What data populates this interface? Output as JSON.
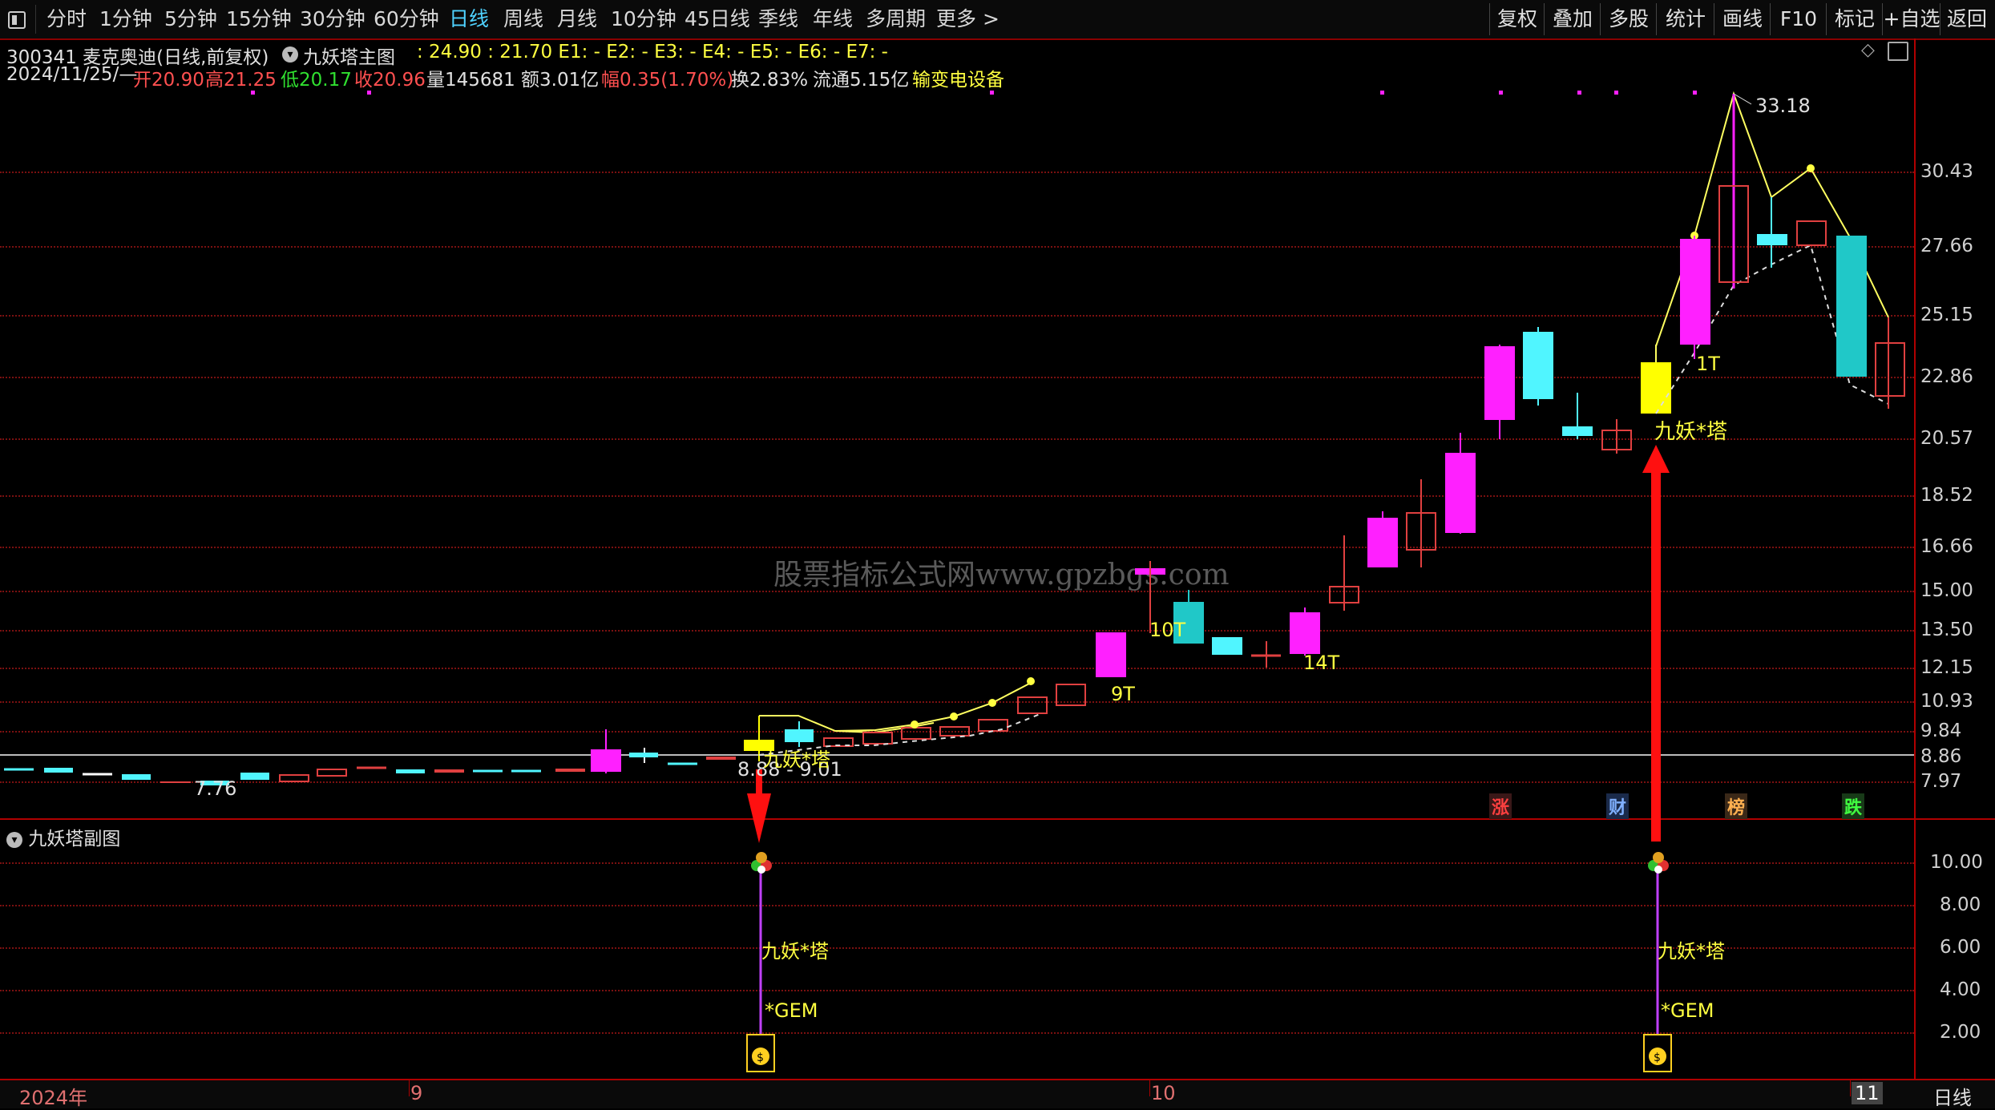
{
  "toolbar": {
    "menu_icon": "panel-toggle-icon",
    "periods": [
      "分时",
      "1分钟",
      "5分钟",
      "15分钟",
      "30分钟",
      "60分钟",
      "日线",
      "周线",
      "月线",
      "10分钟",
      "45日线",
      "季线",
      "年线",
      "多周期",
      "更多"
    ],
    "active_period": "日线",
    "more_arrow": ">",
    "right": [
      "复权",
      "叠加",
      "多股",
      "统计",
      "画线",
      "F10",
      "标记",
      "+自选",
      "返回"
    ]
  },
  "header": {
    "code_name": "300341 麦克奥迪(日线,前复权)",
    "indicator": "九妖塔主图",
    "ind_values": ": 24.90 : 21.70 E1: - E2: - E3: - E4: - E5: - E6: - E7: -",
    "date": "2024/11/25/—",
    "open": "开20.90",
    "high": "高21.25",
    "low": "低20.17",
    "close": "收20.96",
    "volume": "量145681",
    "amount": "额3.01亿",
    "change": "幅0.35(1.70%)",
    "turnover": "换2.83%",
    "float": "流通5.15亿",
    "industry": "输变电设备"
  },
  "main_axis": {
    "labels": [
      "30.43",
      "27.66",
      "25.15",
      "22.86",
      "20.57",
      "18.52",
      "16.66",
      "15.00",
      "13.50",
      "12.15",
      "10.93",
      "9.84",
      "8.86",
      "7.97"
    ]
  },
  "main_annotations": {
    "high_label": "33.18",
    "low_label": "7.76",
    "range_label": "8.88 - 9.01",
    "signal1": "九妖*塔",
    "signal2": "九妖*塔",
    "t9": "9T",
    "t10": "10T",
    "t14": "14T",
    "t1": "1T",
    "badges": [
      "涨",
      "财",
      "榜",
      "跌"
    ]
  },
  "watermark": "股票指标公式网www.gpzbgs.com",
  "sub_panel": {
    "title": "九妖塔副图",
    "axis": [
      "10.00",
      "8.00",
      "6.00",
      "4.00",
      "2.00"
    ],
    "label_a": "九妖*塔",
    "label_b": "*GEM",
    "label_c": "九妖*塔",
    "label_d": "*GEM"
  },
  "x_axis": {
    "labels": [
      "2024年",
      "9",
      "10",
      "11"
    ],
    "period": "日线"
  },
  "colors": {
    "up": "#ff20ff",
    "down": "#50f5ff",
    "hollow": "#e04040",
    "signal": "#ffff00",
    "frame": "#b00000"
  }
}
